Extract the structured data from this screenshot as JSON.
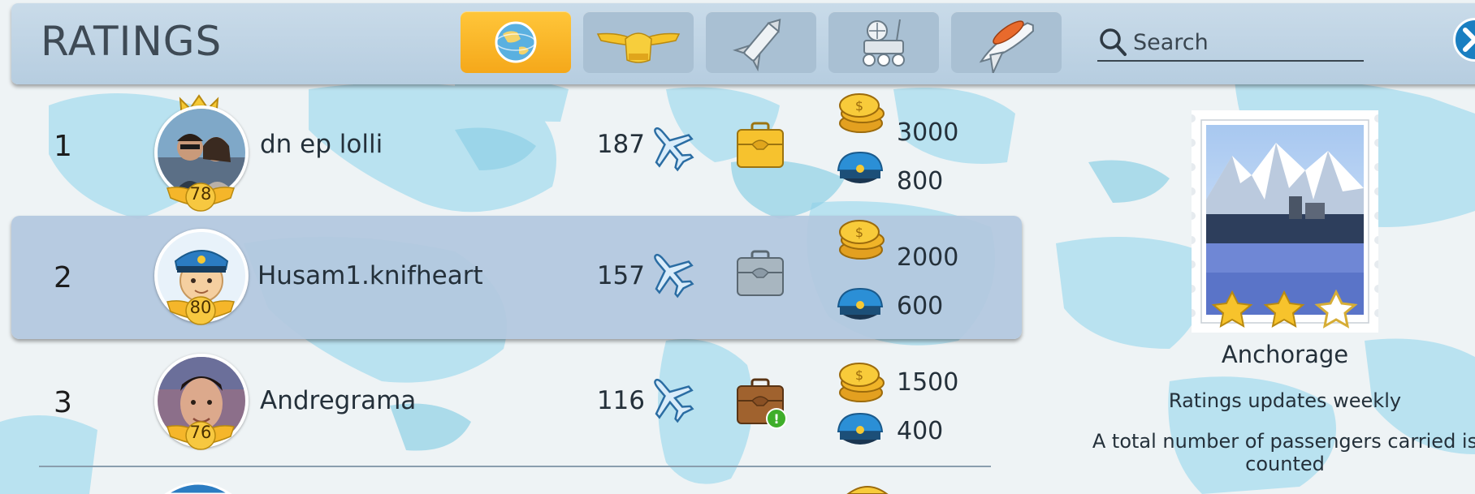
{
  "header": {
    "title": "RATINGS",
    "tabs": [
      {
        "icon": "globe-icon",
        "active": true
      },
      {
        "icon": "pilot-wings-icon",
        "active": false
      },
      {
        "icon": "rocket-icon",
        "active": false
      },
      {
        "icon": "lunar-rover-icon",
        "active": false
      },
      {
        "icon": "space-shuttle-icon",
        "active": false
      }
    ],
    "search": {
      "placeholder": "Search",
      "value": ""
    },
    "close_icon": "close-icon"
  },
  "players": [
    {
      "rank": "1",
      "name": "dn ep lolli",
      "level": "78",
      "score": "187",
      "coins": "3000",
      "caps": "800",
      "case": "gold",
      "crowned": true
    },
    {
      "rank": "2",
      "name": "Husam1.knifheart",
      "level": "80",
      "score": "157",
      "coins": "2000",
      "caps": "600",
      "case": "silver",
      "crowned": false
    },
    {
      "rank": "3",
      "name": "Andregrama",
      "level": "76",
      "score": "116",
      "coins": "1500",
      "caps": "400",
      "case": "bronze",
      "crowned": false
    }
  ],
  "info": {
    "city": "Anchorage",
    "stars": 2,
    "stars_max": 3,
    "note1": "Ratings updates weekly",
    "note2": "A total number of passengers carried is counted"
  },
  "colors": {
    "accent": "#f5a81a",
    "header": "#b6cde0",
    "selected_row": "#b2c8de",
    "text": "#24303a"
  }
}
